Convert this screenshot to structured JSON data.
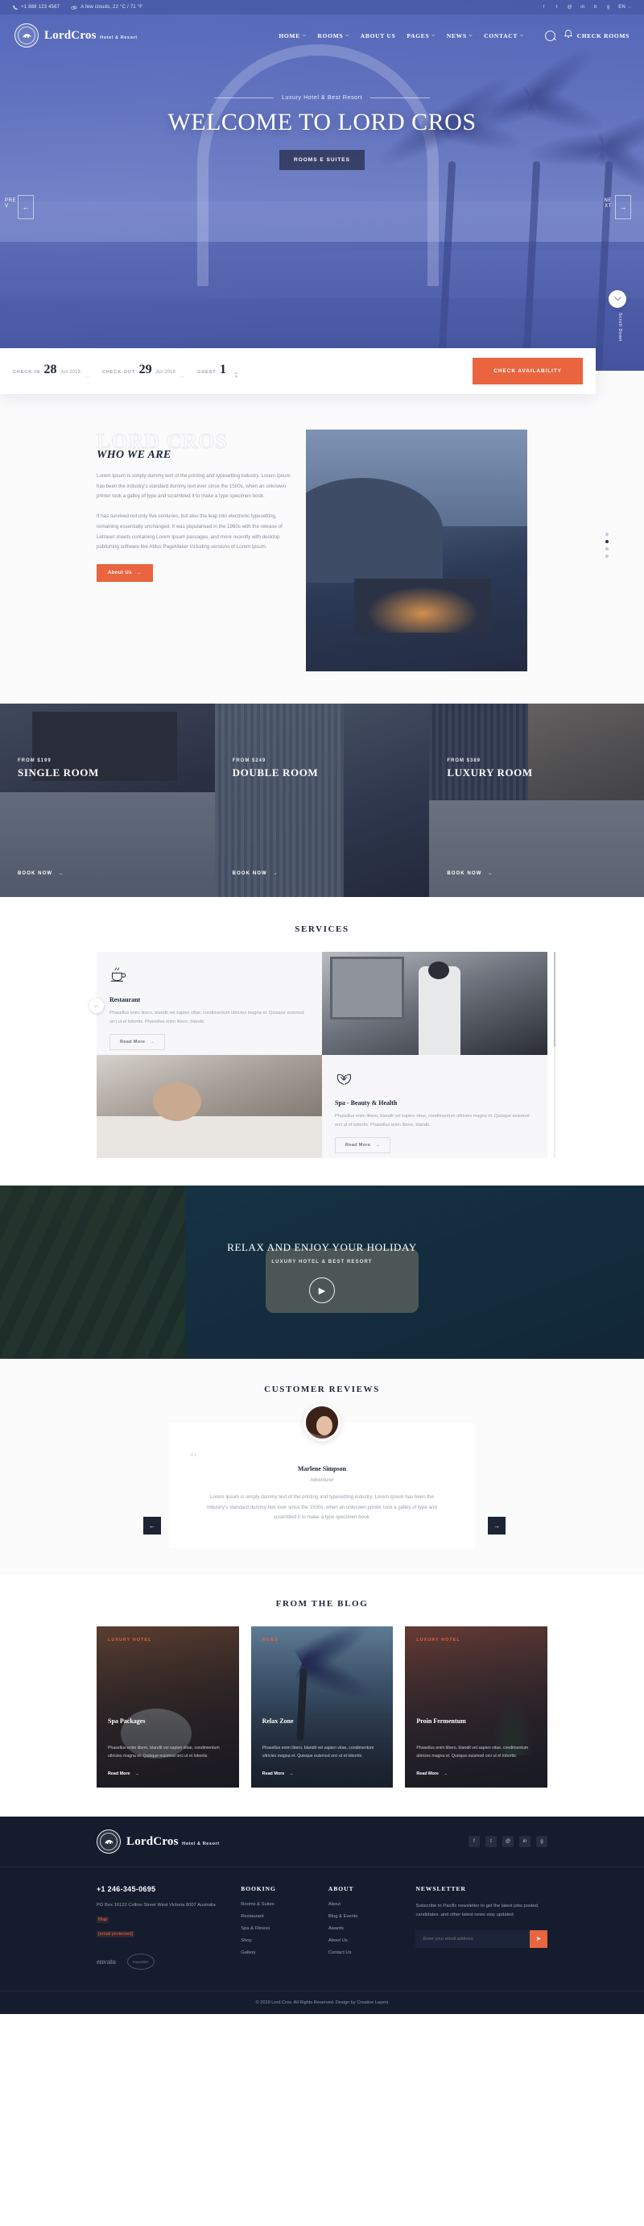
{
  "topbar": {
    "phone": "+1 888 123 4567",
    "weather": "A few clouds, 22 °C / 71 °F",
    "weather_icon": "cloud-icon",
    "socials": [
      "f",
      "t",
      "@",
      "in",
      "b",
      "g"
    ],
    "language": "EN",
    "lang_caret": "⌵"
  },
  "brand": {
    "name": "LordCros",
    "tagline": "Hotel & Resort"
  },
  "nav": {
    "items": [
      {
        "label": "HOME",
        "caret": "⌵"
      },
      {
        "label": "ROOMS",
        "caret": "⌵"
      },
      {
        "label": "ABOUT US",
        "caret": ""
      },
      {
        "label": "PAGES",
        "caret": "⌵"
      },
      {
        "label": "NEWS",
        "caret": "⌵"
      },
      {
        "label": "CONTACT",
        "caret": "⌵"
      }
    ],
    "search_icon": "search-icon",
    "check_rooms": "CHECK ROOMS",
    "bell_icon": "bell-icon"
  },
  "hero": {
    "subtitle": "Luxury Hotel & Best Resort",
    "title": "WELCOME TO LORD CROS",
    "cta": "ROOMS E SUITES",
    "prev_label": "PRE\nV",
    "next_label": "NE\nXT",
    "prev_arrow": "←",
    "next_arrow": "→",
    "scroll_icon": "chevron-down-icon",
    "scroll_label": "Scroll Down"
  },
  "booking": {
    "checkin_label": "CHECK-IN",
    "checkin_day": "28",
    "checkin_month": "Jun 2019",
    "checkout_label": "CHECK-OUT",
    "checkout_day": "29",
    "checkout_month": "Jun 2019",
    "guest_label": "GUEST",
    "guest_value": "1",
    "caret": "⌵",
    "stepper_up": "▲",
    "stepper_down": "▼",
    "submit": "CHECK AVAILABILITY"
  },
  "who": {
    "ghost": "LORD CROS",
    "heading": "WHO WE ARE",
    "p1": "Lorem Ipsum is simply dummy text of the printing and typesetting industry. Lorem Ipsum has been the industry's standard dummy text ever since the 1500s, when an unknown printer took a galley of type and scrambled it to make a type specimen book.",
    "p2": "It has survived not only five centuries, but also the leap into electronic typesetting, remaining essentially unchanged. It was popularised in the 1960s with the release of Letraset sheets containing Lorem Ipsum passages, and more recently with desktop publishing software like Aldus PageMaker including versions of Lorem Ipsum.",
    "button": "About Us",
    "button_arrow": "→"
  },
  "rooms": [
    {
      "from": "FROM $199",
      "name": "SINGLE ROOM",
      "cta": "BOOK NOW",
      "arrow": "→"
    },
    {
      "from": "FROM $249",
      "name": "DOUBLE ROOM",
      "cta": "BOOK NOW",
      "arrow": "→"
    },
    {
      "from": "FROM $389",
      "name": "LUXURY ROOM",
      "cta": "BOOK NOW",
      "arrow": "→"
    }
  ],
  "services": {
    "title": "SERVICES",
    "cards": [
      {
        "icon": "coffee-cup-icon",
        "title": "Restaurant",
        "text": "Phasellus enim libero, blandit vel sapien vitae, condimentum ultricies magna et. Quisque euismod orci ut et lobortis. Phasellus enim libero, blandit.",
        "button": "Read More",
        "arrow": "→"
      },
      {
        "icon": "leaf-icon",
        "title": "Spa - Beauty & Health",
        "text": "Phasellus enim libero, blandit vel sapien vitae, condimentum ultricies magna et. Quisque euismod orci ut et lobortis. Phasellus enim libero, blandit.",
        "button": "Read More",
        "arrow": "→"
      }
    ],
    "prev_arrow": "←"
  },
  "video": {
    "title": "RELAX AND ENJOY YOUR HOLIDAY",
    "subtitle": "LUXURY HOTEL & BEST RESORT",
    "play_icon": "play-icon",
    "play_glyph": "▶"
  },
  "reviews": {
    "title": "CUSTOMER REVIEWS",
    "quote_mark": "“",
    "name": "Marlene Simpson",
    "role": "Adventurer",
    "text": "Lorem Ipsum is simply dummy text of the printing and typesetting industry. Lorem Ipsum has been the industry's standard dummy text ever since the 1500s, when an unknown printer took a galley of type and scrambled it to make a type specimen book.",
    "prev": "←",
    "next": "→"
  },
  "blog": {
    "title": "FROM THE BLOG",
    "posts": [
      {
        "category": "LUXURY HOTEL",
        "title": "Spa Packages",
        "excerpt": "Phasellus enim libero, blandit vel sapien vitae, condimentum ultricies magna et. Quisque euismod orci ut et lobortis.",
        "more": "Read More",
        "arrow": "→"
      },
      {
        "category": "NEWS",
        "title": "Relax Zone",
        "excerpt": "Phasellus enim libero, blandit vel sapien vitae, condimentum ultricies magna et. Quisque euismod orci ut et lobortis.",
        "more": "Read More",
        "arrow": "→"
      },
      {
        "category": "LUXURY HOTEL",
        "title": "Proin Fermentum",
        "excerpt": "Phasellus enim libero, blandit vel sapien vitae, condimentum ultricies magna et. Quisque euismod orci ut et lobortis.",
        "more": "Read More",
        "arrow": "→"
      }
    ]
  },
  "footer": {
    "brand": {
      "name": "LordCros",
      "tagline": "Hotel & Resort"
    },
    "socials": [
      "f",
      "t",
      "@",
      "in",
      "g"
    ],
    "phone": "+1 246-345-0695",
    "address": "PO Box 16122 Collins Street West Victoria 8007 Australia",
    "map_link": "Map",
    "email_link": "[email protected]",
    "badge_envato": "envato",
    "badge_power": "PowerElite",
    "booking": {
      "heading": "BOOKING",
      "links": [
        "Rooms & Suites",
        "Restaurant",
        "Spa & Fitness",
        "Shop",
        "Gallery"
      ]
    },
    "about": {
      "heading": "ABOUT",
      "links": [
        "About",
        "Blog & Events",
        "Awards",
        "About Us",
        "Contact Us"
      ]
    },
    "newsletter": {
      "heading": "NEWSLETTER",
      "text": "Subscribe to Pacific newsletter to get the latest jobs posted, candidates ,and other latest news stay updated.",
      "placeholder": "Enter your email address",
      "send_icon": "send-icon",
      "send_glyph": "➤"
    },
    "copyright": "© 2019 Lord Cros. All Rights Reserved. Design by Creative Layers"
  },
  "colors": {
    "accent": "#e9643f",
    "dark": "#141c2e",
    "hero": "#4a5fb0"
  }
}
